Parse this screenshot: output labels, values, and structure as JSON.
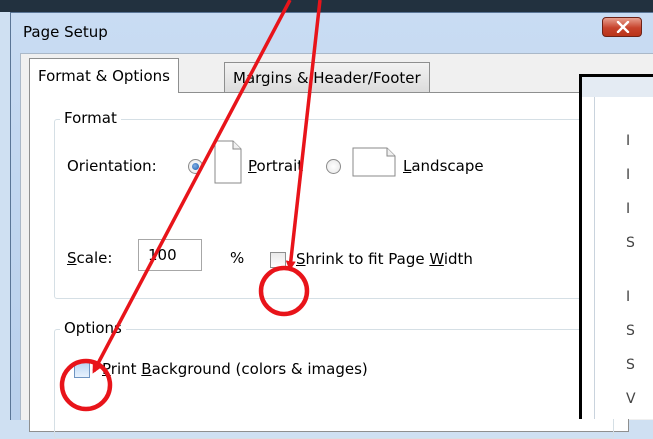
{
  "window": {
    "title": "Page Setup",
    "close_label": "X"
  },
  "tabs": [
    {
      "label": "Format & Options",
      "active": true
    },
    {
      "label": "Margins & Header/Footer",
      "active": false
    }
  ],
  "format": {
    "group_label": "Format",
    "orientation_label": "Orientation:",
    "portrait_pre": "",
    "portrait_u": "P",
    "portrait_post": "ortrait",
    "landscape_pre": "",
    "landscape_u": "L",
    "landscape_post": "andscape",
    "selected": "portrait",
    "scale_pre": "",
    "scale_u": "S",
    "scale_post": "cale:",
    "scale_value": "100",
    "percent": "%",
    "shrink_pre": "",
    "shrink_u": "S",
    "shrink_mid": "hrink to fit Page ",
    "shrink_u2": "W",
    "shrink_post": "idth",
    "shrink_checked": false
  },
  "options": {
    "group_label": "Options",
    "bg_pre": "",
    "bg_u": "P",
    "bg_mid": "rint ",
    "bg_u2": "B",
    "bg_post": "ackground (colors & images)",
    "bg_checked": false
  },
  "background_window": {
    "fragments": [
      "I",
      "I",
      "I",
      "S",
      "I",
      "S",
      "S",
      "V"
    ]
  },
  "colors": {
    "annotation": "#e8141a",
    "accent": "#1a56a3"
  }
}
